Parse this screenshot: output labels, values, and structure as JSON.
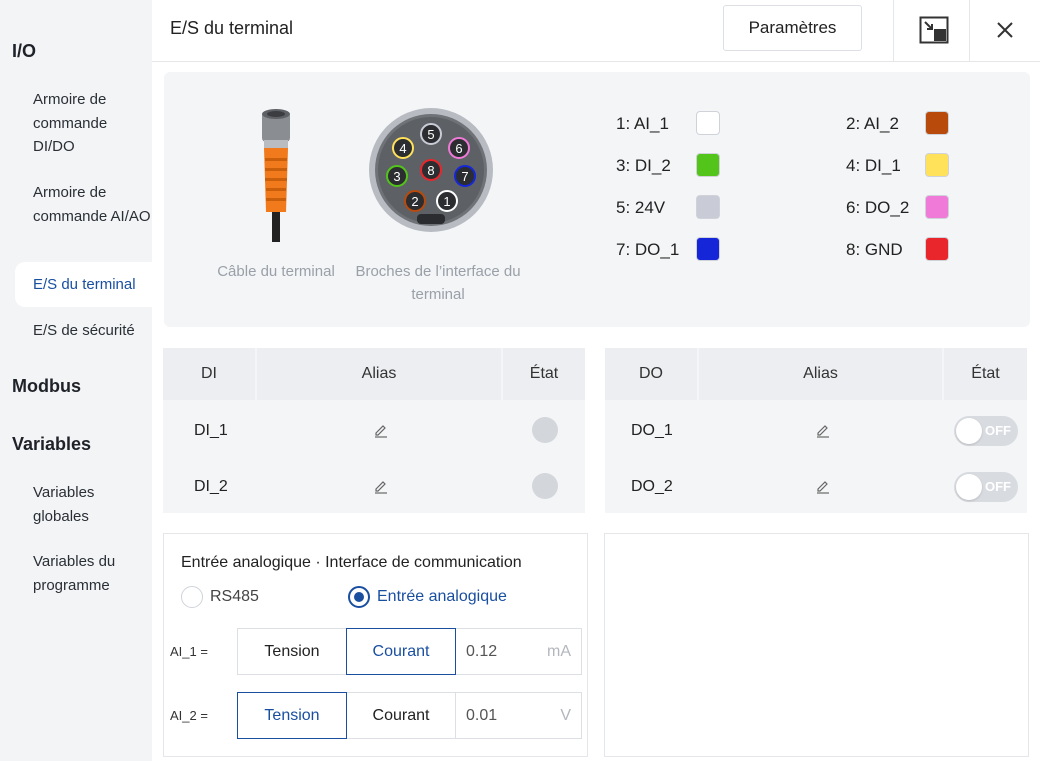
{
  "sidebar": {
    "sections": [
      {
        "title": "I/O"
      },
      {
        "title": "Modbus"
      },
      {
        "title": "Variables"
      }
    ],
    "items": [
      {
        "label": "Armoire de commande DI/DO"
      },
      {
        "label": "Armoire de commande AI/AO"
      },
      {
        "label": "E/S du terminal"
      },
      {
        "label": "E/S de sécurité"
      },
      {
        "label": "Variables globales"
      },
      {
        "label": "Variables du programme"
      }
    ]
  },
  "header": {
    "title": "E/S du terminal",
    "params_label": "Paramètres",
    "icons": [
      "exit-fullscreen-icon",
      "close-icon"
    ]
  },
  "connector": {
    "cable_caption": "Câble du terminal",
    "pins_caption": "Broches de l’interface du terminal",
    "pin_numbers": [
      "1",
      "2",
      "3",
      "4",
      "5",
      "6",
      "7",
      "8"
    ]
  },
  "pins": [
    {
      "label": "1:  AI_1",
      "color": "#ffffff"
    },
    {
      "label": "2:  AI_2",
      "color": "#b84a0c"
    },
    {
      "label": "3:  DI_2",
      "color": "#52c41a"
    },
    {
      "label": "4:  DI_1",
      "color": "#ffe15a"
    },
    {
      "label": "5:  24V",
      "color": "#c9cbd6"
    },
    {
      "label": "6:  DO_2",
      "color": "#f07ad8"
    },
    {
      "label": "7:  DO_1",
      "color": "#1526d8"
    },
    {
      "label": "8:  GND",
      "color": "#e8262c"
    }
  ],
  "di_table": {
    "headers": [
      "DI",
      "Alias",
      "État"
    ],
    "rows": [
      {
        "name": "DI_1",
        "state": "off"
      },
      {
        "name": "DI_2",
        "state": "off"
      }
    ]
  },
  "do_table": {
    "headers": [
      "DO",
      "Alias",
      "État"
    ],
    "rows": [
      {
        "name": "DO_1",
        "toggle": "OFF"
      },
      {
        "name": "DO_2",
        "toggle": "OFF"
      }
    ]
  },
  "analog": {
    "title": "Entrée analogique · Interface de communication",
    "radio_options": [
      "RS485",
      "Entrée analogique"
    ],
    "selected_radio": "Entrée analogique",
    "channels": [
      {
        "label": "AI_1 =",
        "opt_voltage": "Tension",
        "opt_current": "Courant",
        "selected": "Courant",
        "value": "0.12",
        "unit": "mA"
      },
      {
        "label": "AI_2 =",
        "opt_voltage": "Tension",
        "opt_current": "Courant",
        "selected": "Tension",
        "value": "0.01",
        "unit": "V"
      }
    ]
  },
  "colors": {
    "accent": "#1a4fa0",
    "cable_orange": "#f07a1c"
  }
}
